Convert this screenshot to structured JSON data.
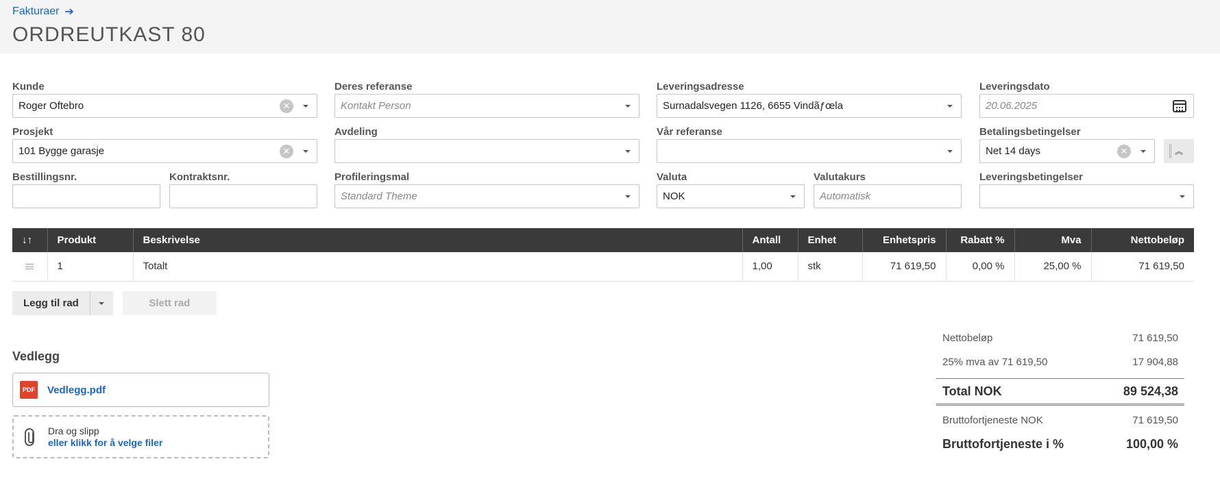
{
  "header": {
    "breadcrumb": "Fakturaer",
    "title": "ORDREUTKAST 80"
  },
  "form": {
    "kunde": {
      "label": "Kunde",
      "value": "Roger Oftebro"
    },
    "deres_referanse": {
      "label": "Deres referanse",
      "placeholder": "Kontakt Person"
    },
    "leveringsadresse": {
      "label": "Leveringsadresse",
      "value": "Surnadalsvegen 1126, 6655 Vindãƒœla"
    },
    "leveringsdato": {
      "label": "Leveringsdato",
      "placeholder": "20.06.2025"
    },
    "prosjekt": {
      "label": "Prosjekt",
      "value": "101 Bygge garasje"
    },
    "avdeling": {
      "label": "Avdeling",
      "value": ""
    },
    "var_referanse": {
      "label": "Vår referanse",
      "value": ""
    },
    "betalingsbetingelser": {
      "label": "Betalingsbetingelser",
      "value": "Net 14 days"
    },
    "bestillingsnr": {
      "label": "Bestillingsnr.",
      "value": ""
    },
    "kontraktsnr": {
      "label": "Kontraktsnr.",
      "value": ""
    },
    "profileringsmal": {
      "label": "Profileringsmal",
      "placeholder": "Standard Theme"
    },
    "valuta": {
      "label": "Valuta",
      "value": "NOK"
    },
    "valutakurs": {
      "label": "Valutakurs",
      "placeholder": "Automatisk"
    },
    "leveringsbetingelser": {
      "label": "Leveringsbetingelser",
      "value": ""
    }
  },
  "table": {
    "columns": {
      "sort": "↓↑",
      "produkt": "Produkt",
      "beskrivelse": "Beskrivelse",
      "antall": "Antall",
      "enhet": "Enhet",
      "enhetspris": "Enhetspris",
      "rabatt": "Rabatt %",
      "mva": "Mva",
      "nettobelop": "Nettobeløp"
    },
    "rows": [
      {
        "produkt": "1",
        "beskrivelse": "Totalt",
        "antall": "1,00",
        "enhet": "stk",
        "enhetspris": "71 619,50",
        "rabatt": "0,00 %",
        "mva": "25,00 %",
        "nettobelop": "71 619,50"
      }
    ]
  },
  "actions": {
    "add_row": "Legg til rad",
    "delete_row": "Slett rad"
  },
  "attachments": {
    "title": "Vedlegg",
    "file_name": "Vedlegg.pdf",
    "pdf_label": "PDF",
    "drop_line1": "Dra og slipp",
    "drop_line2": "eller klikk for å velge filer"
  },
  "summary": {
    "netto_label": "Nettobeløp",
    "netto_value": "71 619,50",
    "mva_label": "25% mva av 71 619,50",
    "mva_value": "17 904,88",
    "total_label": "Total NOK",
    "total_value": "89 524,38",
    "profit_label": "Bruttofortjeneste NOK",
    "profit_value": "71 619,50",
    "profit_pct_label": "Bruttofortjeneste i %",
    "profit_pct_value": "100,00 %"
  }
}
